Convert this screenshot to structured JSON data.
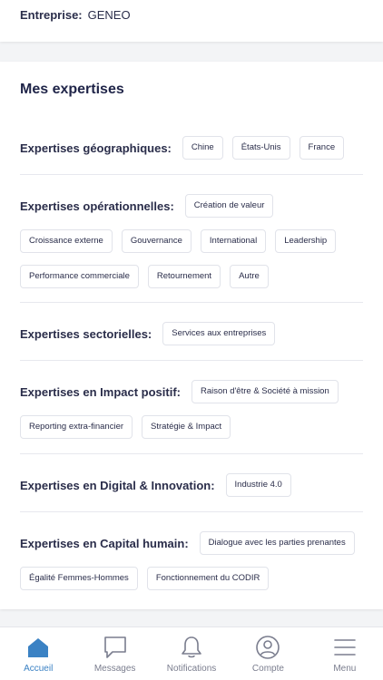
{
  "header": {
    "company_label": "Entreprise:",
    "company_value": "GENEO"
  },
  "expertises": {
    "title": "Mes expertises",
    "groups": [
      {
        "label": "Expertises géographiques:",
        "chips": [
          "Chine",
          "États-Unis",
          "France"
        ]
      },
      {
        "label": "Expertises opérationnelles:",
        "chips": [
          "Création de valeur",
          "Croissance externe",
          "Gouvernance",
          "International",
          "Leadership",
          "Performance commerciale",
          "Retournement",
          "Autre"
        ]
      },
      {
        "label": "Expertises sectorielles:",
        "chips": [
          "Services aux entreprises"
        ]
      },
      {
        "label": "Expertises en Impact positif:",
        "chips": [
          "Raison d'être & Société à mission",
          "Reporting extra-financier",
          "Stratégie & Impact"
        ]
      },
      {
        "label": "Expertises en Digital & Innovation:",
        "chips": [
          "Industrie 4.0"
        ]
      },
      {
        "label": "Expertises en Capital humain:",
        "chips": [
          "Dialogue avec les parties prenantes",
          "Égalité Femmes-Hommes",
          "Fonctionnement du CODIR"
        ]
      }
    ]
  },
  "nav": {
    "items": [
      {
        "label": "Accueil",
        "icon": "home-icon",
        "active": true
      },
      {
        "label": "Messages",
        "icon": "message-icon",
        "active": false
      },
      {
        "label": "Notifications",
        "icon": "bell-icon",
        "active": false
      },
      {
        "label": "Compte",
        "icon": "account-icon",
        "active": false
      },
      {
        "label": "Menu",
        "icon": "menu-icon",
        "active": false
      }
    ],
    "active_color": "#3b82c4",
    "inactive_color": "#7a7d8e"
  }
}
